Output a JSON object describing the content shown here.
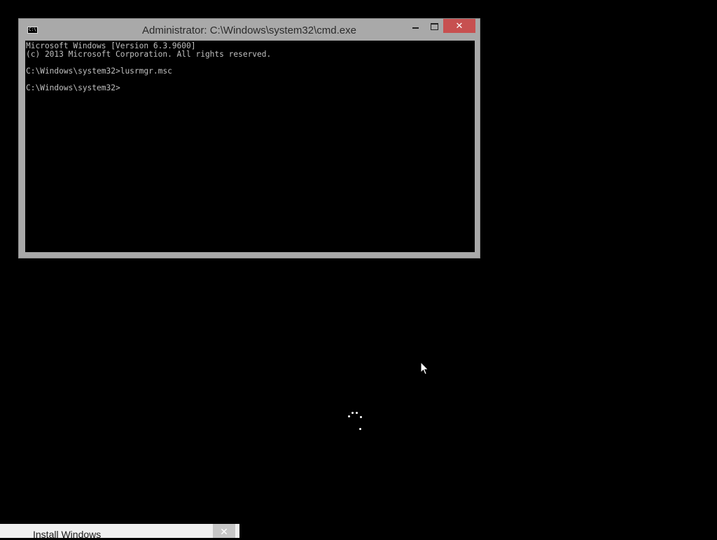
{
  "cmd_window": {
    "title": "Administrator: C:\\Windows\\system32\\cmd.exe",
    "icon_label": "C:\\",
    "controls": {
      "minimize_icon": "minimize-icon",
      "maximize_icon": "maximize-icon",
      "close_glyph": "✕"
    },
    "console_lines": [
      "Microsoft Windows [Version 6.3.9600]",
      "(c) 2013 Microsoft Corporation. All rights reserved.",
      "",
      "C:\\Windows\\system32>lusrmgr.msc",
      "",
      "C:\\Windows\\system32>"
    ]
  },
  "install_window": {
    "title": "Install Windows",
    "close_glyph": "✕"
  },
  "colors": {
    "desktop_bg": "#000000",
    "window_frame": "#a9a9a9",
    "close_button": "#c75050",
    "console_text": "#c0c0c0"
  }
}
